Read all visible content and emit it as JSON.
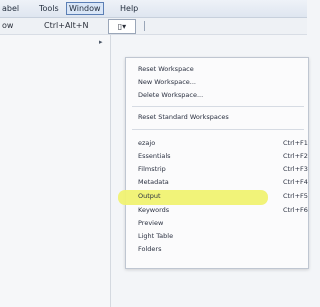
{
  "menubar": {
    "items": [
      {
        "label": "abel"
      },
      {
        "label": "Tools"
      },
      {
        "label": "Window"
      },
      {
        "label": "Help"
      }
    ]
  },
  "toolbar": {
    "left_text": "ow",
    "shortcut_text": "Ctrl+Alt+N",
    "button_label": "▯▾"
  },
  "submenu_arrow": "▸",
  "menu": {
    "items": [
      {
        "label": "Reset Workspace",
        "shortcut": ""
      },
      {
        "label": "New Workspace...",
        "shortcut": ""
      },
      {
        "label": "Delete Workspace...",
        "shortcut": ""
      },
      {
        "label": "Reset Standard Workspaces",
        "shortcut": ""
      },
      {
        "label": "ezajo",
        "shortcut": "Ctrl+F1"
      },
      {
        "label": "Essentials",
        "shortcut": "Ctrl+F2"
      },
      {
        "label": "Filmstrip",
        "shortcut": "Ctrl+F3"
      },
      {
        "label": "Metadata",
        "shortcut": "Ctrl+F4"
      },
      {
        "label": "Output",
        "shortcut": "Ctrl+F5"
      },
      {
        "label": "Keywords",
        "shortcut": "Ctrl+F6"
      },
      {
        "label": "Preview",
        "shortcut": ""
      },
      {
        "label": "Light Table",
        "shortcut": ""
      },
      {
        "label": "Folders",
        "shortcut": ""
      }
    ],
    "highlighted": "Output",
    "highlight_color": "#f0f272"
  }
}
